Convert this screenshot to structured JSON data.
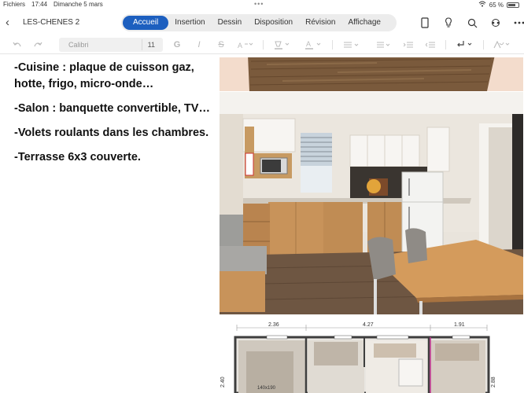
{
  "status": {
    "app": "Fichiers",
    "time": "17:44",
    "date": "Dimanche 5 mars",
    "battery": "65 %"
  },
  "header": {
    "document_title": "LES-CHENES 2",
    "tabs": [
      "Accueil",
      "Insertion",
      "Dessin",
      "Disposition",
      "Révision",
      "Affichage"
    ]
  },
  "toolbar": {
    "font_name": "Calibri",
    "font_size": "11",
    "bold": "G",
    "italic": "I",
    "strikethrough": "S"
  },
  "document": {
    "paragraphs": [
      "-Cuisine : plaque de cuisson gaz, hotte, frigo, micro-onde…",
      "-Salon : banquette convertible, TV…",
      "-Volets roulants dans les chambres.",
      "-Terrasse 6x3 couverte."
    ]
  },
  "floor_plan": {
    "dims": [
      "2.36",
      "4.27",
      "1.91"
    ],
    "side_dims": [
      "2.40",
      "2.88"
    ],
    "room_label": "140x190"
  },
  "colors": {
    "accent": "#1d5fbf",
    "floor_bg": "#f3dccc",
    "wood": "#8a6a4a"
  }
}
